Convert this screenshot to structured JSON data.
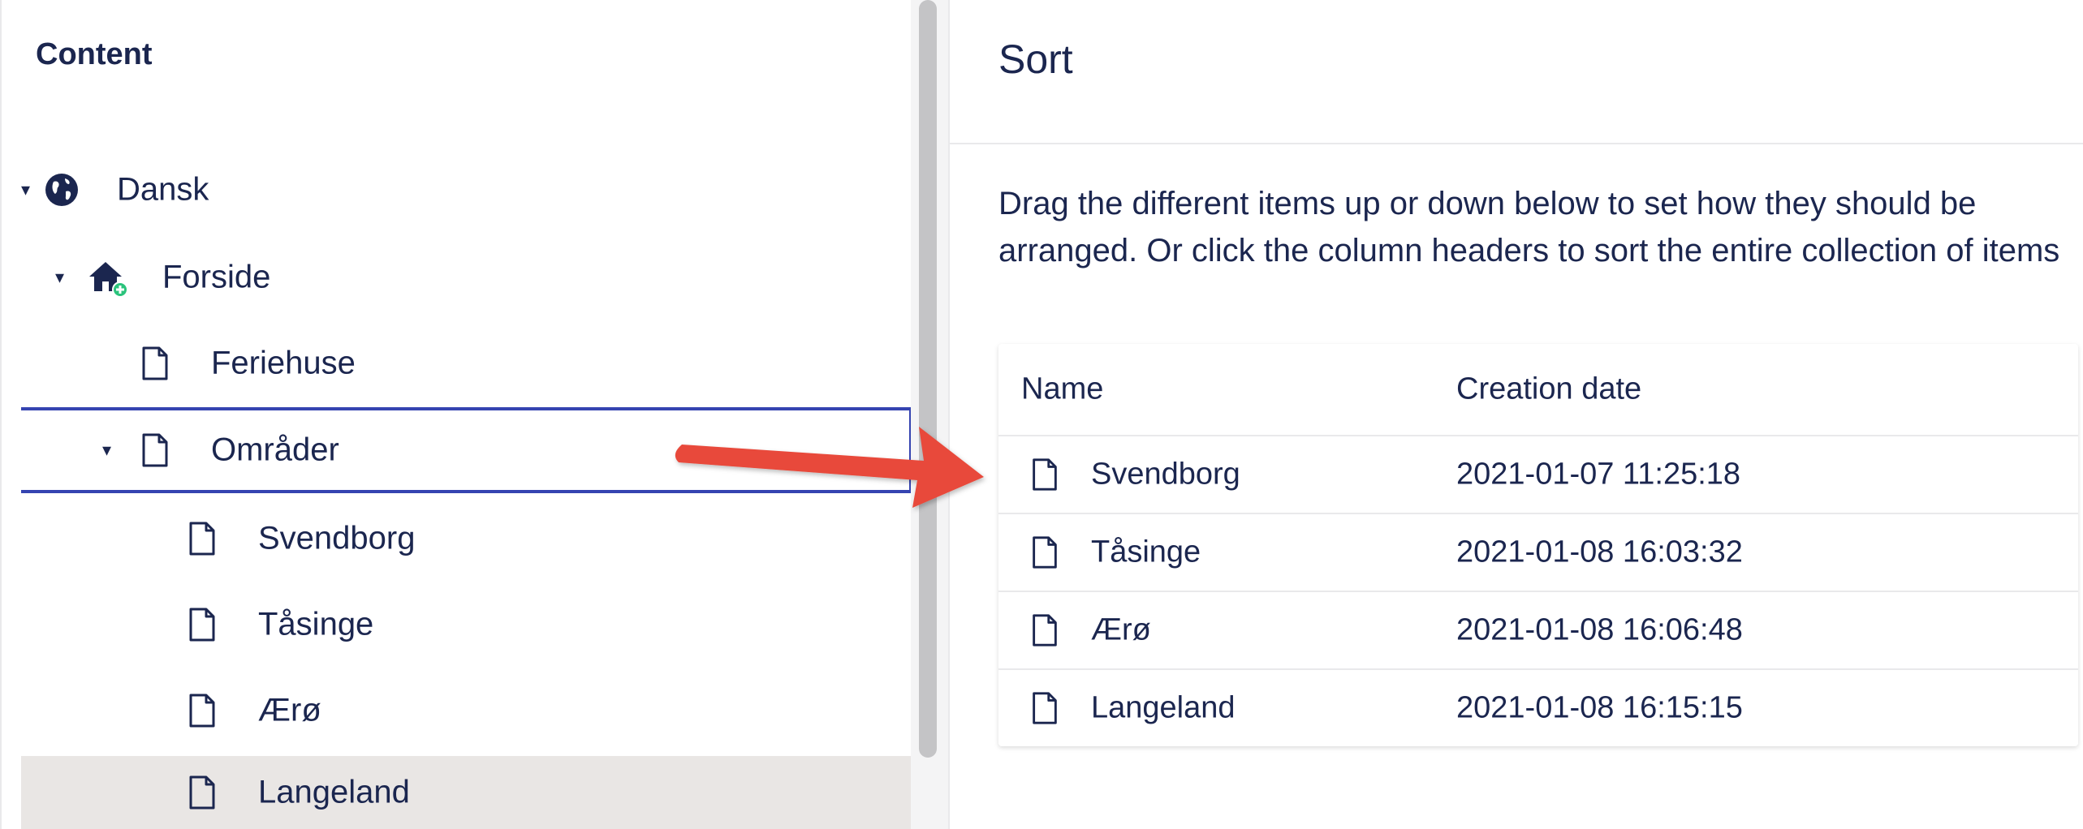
{
  "tree": {
    "title": "Content",
    "items": [
      {
        "label": "Dansk",
        "icon": "globe-icon"
      },
      {
        "label": "Forside",
        "icon": "home-add-icon"
      },
      {
        "label": "Feriehuse",
        "icon": "document-icon"
      },
      {
        "label": "Områder",
        "icon": "document-icon"
      },
      {
        "label": "Svendborg",
        "icon": "document-icon"
      },
      {
        "label": "Tåsinge",
        "icon": "document-icon"
      },
      {
        "label": "Ærø",
        "icon": "document-icon"
      },
      {
        "label": "Langeland",
        "icon": "document-icon"
      }
    ]
  },
  "sort": {
    "title": "Sort",
    "description": "Drag the different items up or down below to set how they should be arranged. Or click the column headers to sort the entire collection of items",
    "columns": [
      "Name",
      "Creation date"
    ],
    "rows": [
      {
        "name": "Svendborg",
        "date": "2021-01-07 11:25:18"
      },
      {
        "name": "Tåsinge",
        "date": "2021-01-08 16:03:32"
      },
      {
        "name": "Ærø",
        "date": "2021-01-08 16:06:48"
      },
      {
        "name": "Langeland",
        "date": "2021-01-08 16:15:15"
      }
    ]
  },
  "colors": {
    "text": "#1b264f",
    "selection_border": "#3544b1",
    "active_row": "#e9e6e4",
    "arrow": "#e84a3a",
    "add_badge": "#2bc37c"
  }
}
